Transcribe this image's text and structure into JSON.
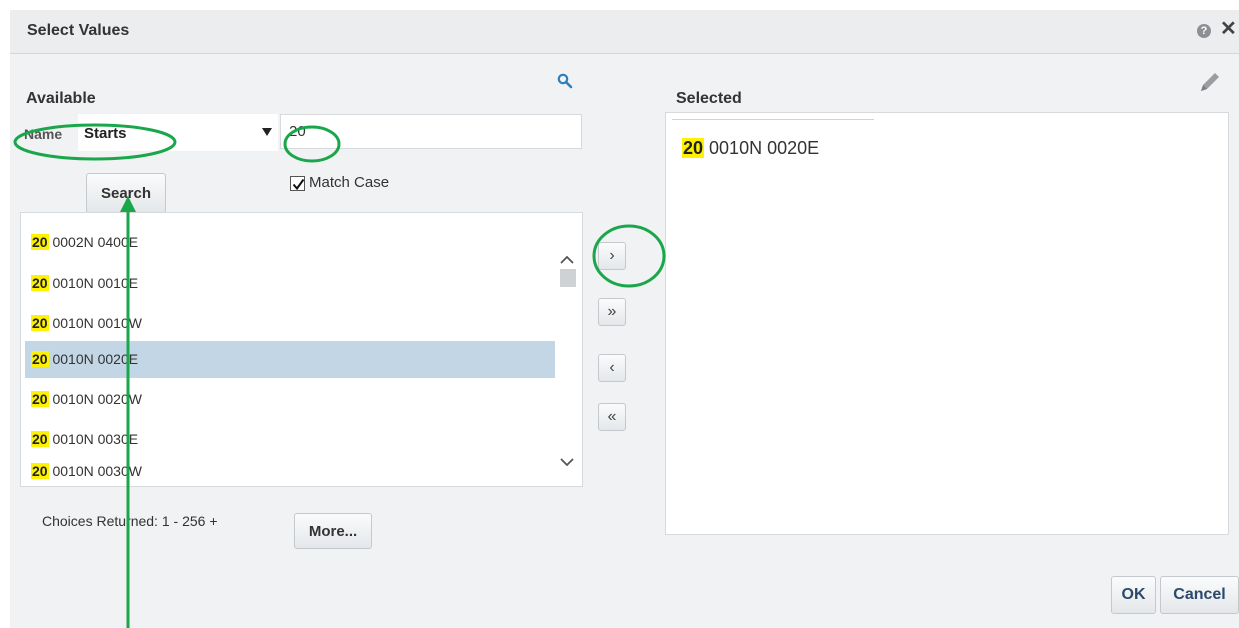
{
  "dialog": {
    "title": "Select Values",
    "help_icon": "question-circle-icon",
    "close_icon": "close-icon"
  },
  "available": {
    "heading": "Available",
    "name_label": "Name",
    "operator": "Starts",
    "value": "20",
    "search_button": "Search",
    "match_case_label": "Match Case",
    "match_case_checked": true,
    "items": [
      {
        "prefix": "20",
        "rest": " 0002N 0400E",
        "selected": false
      },
      {
        "prefix": "20",
        "rest": " 0010N 0010E",
        "selected": false
      },
      {
        "prefix": "20",
        "rest": " 0010N 0010W",
        "selected": false
      },
      {
        "prefix": "20",
        "rest": " 0010N 0020E",
        "selected": true
      },
      {
        "prefix": "20",
        "rest": " 0010N 0020W",
        "selected": false
      },
      {
        "prefix": "20",
        "rest": " 0010N 0030E",
        "selected": false
      },
      {
        "prefix": "20",
        "rest": " 0010N 0030W",
        "selected": false
      }
    ],
    "choices_text": "Choices Returned: 1 - 256 +",
    "more_button": "More..."
  },
  "shuttle": {
    "move": "›",
    "move_all": "»",
    "remove": "‹",
    "remove_all": "«"
  },
  "selected": {
    "heading": "Selected",
    "items": [
      {
        "prefix": "20",
        "rest": " 0010N 0020E"
      }
    ]
  },
  "footer": {
    "ok": "OK",
    "cancel": "Cancel"
  },
  "colors": {
    "highlight": "#fff200",
    "selection": "#c3d6e5",
    "annotation": "#1aa64a",
    "accent": "#2a7fc1"
  }
}
